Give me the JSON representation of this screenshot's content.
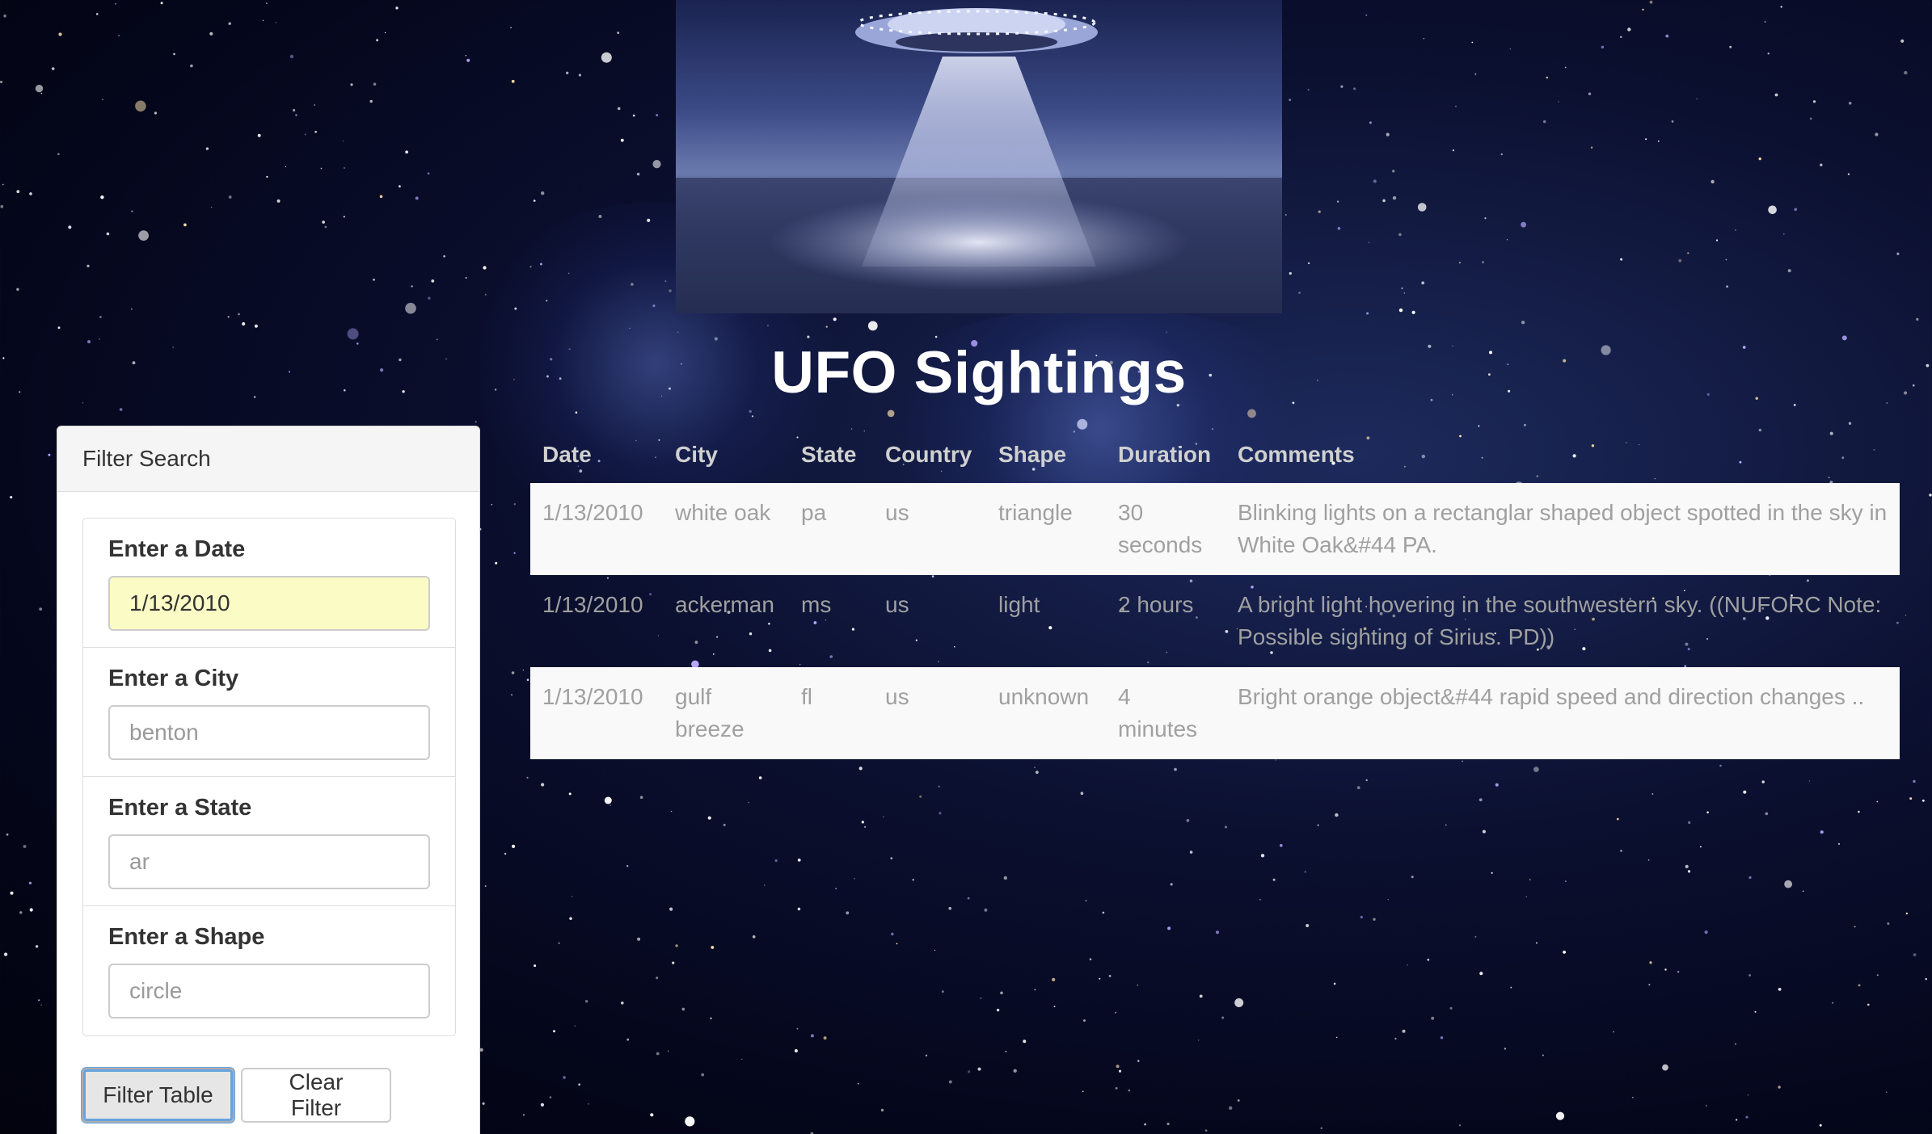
{
  "page": {
    "title": "UFO Sightings"
  },
  "filter": {
    "heading": "Filter Search",
    "fields": [
      {
        "label": "Enter a Date",
        "value": "1/13/2010",
        "placeholder": ""
      },
      {
        "label": "Enter a City",
        "value": "",
        "placeholder": "benton"
      },
      {
        "label": "Enter a State",
        "value": "",
        "placeholder": "ar"
      },
      {
        "label": "Enter a Shape",
        "value": "",
        "placeholder": "circle"
      }
    ],
    "filter_button": "Filter Table",
    "clear_button": "Clear Filter"
  },
  "table": {
    "columns": [
      "Date",
      "City",
      "State",
      "Country",
      "Shape",
      "Duration",
      "Comments"
    ],
    "rows": [
      [
        "1/13/2010",
        "white oak",
        "pa",
        "us",
        "triangle",
        "30 seconds",
        "Blinking lights on a rectanglar shaped object spotted in the sky in White Oak&#44 PA."
      ],
      [
        "1/13/2010",
        "ackerman",
        "ms",
        "us",
        "light",
        "2 hours",
        "A bright light hovering in the southwestern sky. ((NUFORC Note: Possible sighting of Sirius. PD))"
      ],
      [
        "1/13/2010",
        "gulf breeze",
        "fl",
        "us",
        "unknown",
        "4 minutes",
        "Bright orange object&#44 rapid speed and direction changes .."
      ]
    ]
  },
  "colors": {
    "background": "#05071c",
    "date_highlight": "#fbfbc6",
    "focus_ring": "#66a3e0"
  }
}
